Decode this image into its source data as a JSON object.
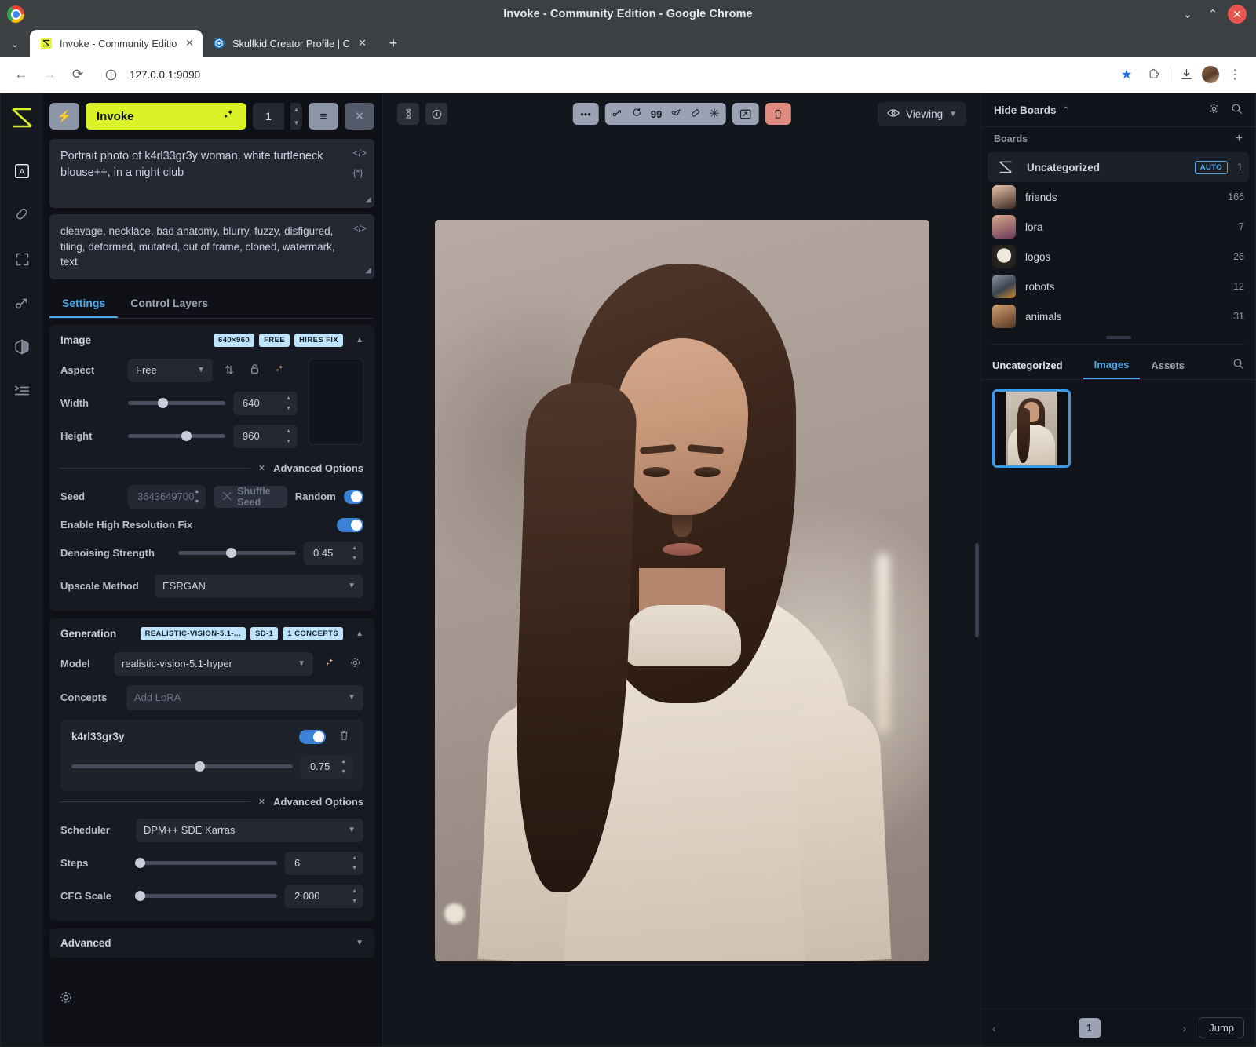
{
  "window": {
    "title": "Invoke - Community Edition - Google Chrome",
    "minimize": "⌄",
    "maximize": "⌃",
    "close": "✕"
  },
  "tabs": [
    {
      "label": "Invoke - Community Edition",
      "favicon": "invoke-logo-icon",
      "close": "✕"
    },
    {
      "label": "Skullkid Creator Profile | Civit",
      "favicon": "civitai-icon",
      "close": "✕"
    }
  ],
  "newtab_label": "+",
  "omnibox": {
    "back": "←",
    "forward": "→",
    "reload": "⟳",
    "info_icon": "info-circle-icon",
    "url": "127.0.0.1:9090",
    "bookmark_star": "★",
    "extensions": "puzzle-icon",
    "downloads": "download-icon",
    "profile": "avatar",
    "menu": "⋮"
  },
  "rail": {
    "logo": "invoke-logo-icon",
    "items": [
      {
        "name": "text-to-image",
        "glyph": "A",
        "active": true
      },
      {
        "name": "canvas-brush",
        "glyph": "brush"
      },
      {
        "name": "upscale-expand",
        "glyph": "expand"
      },
      {
        "name": "workflows-nodes",
        "glyph": "node"
      },
      {
        "name": "models-cube",
        "glyph": "cube"
      },
      {
        "name": "queue-list",
        "glyph": "queue"
      }
    ],
    "settings_gear": "gear-icon"
  },
  "left_panel": {
    "bolt_button": "⚡",
    "invoke_button": "Invoke",
    "invoke_sparkle": "✦",
    "iterations": "1",
    "queue_button": "≡",
    "cancel_button": "✕",
    "prompt": "Portrait photo of k4rl33gr3y woman, white turtleneck blouse++, in a night club",
    "negative_prompt": "cleavage, necklace, bad anatomy, blurry, fuzzy, disfigured, tiling, deformed, mutated, out of frame, cloned, watermark, text",
    "code_icon": "</>",
    "wildcard_icon": "{*}",
    "tabs": [
      {
        "label": "Settings",
        "active": true
      },
      {
        "label": "Control Layers",
        "active": false
      }
    ],
    "image_section": {
      "title": "Image",
      "badges": [
        "640×960",
        "FREE",
        "HIRES FIX"
      ],
      "aspect_label": "Aspect",
      "aspect_value": "Free",
      "swap_icon": "swap-icon",
      "lock_icon": "lock-icon",
      "sparkle_icon": "sparkle-icon",
      "width_label": "Width",
      "width_value": "640",
      "height_label": "Height",
      "height_value": "960",
      "advanced_label": "Advanced Options",
      "seed_label": "Seed",
      "seed_value": "3643649700",
      "shuffle_seed_label": "Shuffle Seed",
      "random_label": "Random",
      "random_on": true,
      "hires_label": "Enable High Resolution Fix",
      "hires_on": true,
      "denoise_label": "Denoising Strength",
      "denoise_value": "0.45",
      "upscale_label": "Upscale Method",
      "upscale_value": "ESRGAN"
    },
    "generation_section": {
      "title": "Generation",
      "badges": [
        "REALISTIC-VISION-5.1-...",
        "SD-1",
        "1 CONCEPTS"
      ],
      "model_label": "Model",
      "model_value": "realistic-vision-5.1-hyper",
      "model_sparkle_icon": "sparkle-icon",
      "model_gear_icon": "gear-icon",
      "concepts_label": "Concepts",
      "concepts_placeholder": "Add LoRA",
      "lora_name": "k4rl33gr3y",
      "lora_enabled": true,
      "lora_weight": "0.75",
      "lora_delete_icon": "trash-icon",
      "advanced_label": "Advanced Options",
      "scheduler_label": "Scheduler",
      "scheduler_value": "DPM++ SDE Karras",
      "steps_label": "Steps",
      "steps_value": "6",
      "cfg_label": "CFG Scale",
      "cfg_value": "2.000"
    },
    "advanced_section": {
      "title": "Advanced"
    }
  },
  "center": {
    "toolbar": {
      "left_buttons": [
        "hourglass-icon",
        "info-icon"
      ],
      "more_button": "•••",
      "tool_icons": [
        "bezier-icon",
        "rotate-icon",
        "quote-icon",
        "leaf-icon",
        "eraser-icon",
        "asterisk-icon"
      ],
      "fit_button": "fit-icon",
      "delete_button": "trash-icon",
      "viewing_label": "Viewing",
      "viewing_eye_icon": "eye-icon",
      "viewing_chevron": "⌄"
    }
  },
  "right_panel": {
    "hide_boards_label": "Hide Boards",
    "hide_boards_chevron": "⌃",
    "settings_icon": "gear-icon",
    "search_icon": "search-icon",
    "boards_label": "Boards",
    "add_board_icon": "+",
    "boards": [
      {
        "name": "Uncategorized",
        "count": "1",
        "auto": "AUTO",
        "selected": true,
        "thumb": "invoke-logo-icon"
      },
      {
        "name": "friends",
        "count": "166",
        "thumb": "face-woman-1"
      },
      {
        "name": "lora",
        "count": "7",
        "thumb": "face-woman-glasses"
      },
      {
        "name": "logos",
        "count": "26",
        "thumb": "logo-sketch"
      },
      {
        "name": "robots",
        "count": "12",
        "thumb": "robot"
      },
      {
        "name": "animals",
        "count": "31",
        "thumb": "cat"
      }
    ],
    "gallery_tabs": {
      "board_title": "Uncategorized",
      "tabs": [
        {
          "label": "Images",
          "active": true
        },
        {
          "label": "Assets",
          "active": false
        }
      ],
      "search_icon": "search-icon"
    },
    "pager": {
      "prev": "‹",
      "page": "1",
      "next": "›",
      "jump_label": "Jump"
    }
  },
  "colors": {
    "accent_yellow": "#dbf227",
    "accent_blue": "#4aa8e8",
    "toggle_blue": "#3b82d6",
    "badge_blue": "#bfe3fb",
    "danger_red": "#e08b82",
    "panel_bg": "#0f1117",
    "card_bg": "#171a22"
  }
}
